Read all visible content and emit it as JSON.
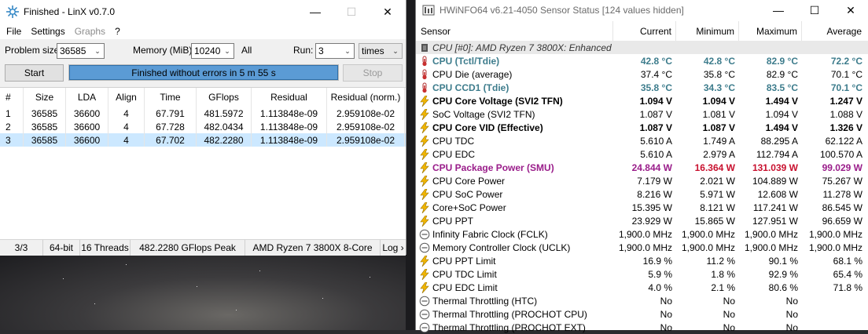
{
  "linx": {
    "title": "Finished - LinX v0.7.0",
    "menu": [
      "File",
      "Settings",
      "Graphs",
      "?"
    ],
    "problem_size_label": "Problem size:",
    "problem_size_value": "36585",
    "memory_label": "Memory (MiB):",
    "memory_value": "10240",
    "all_label": "All",
    "run_label": "Run:",
    "run_value": "3",
    "run_unit": "times",
    "start_label": "Start",
    "stop_label": "Stop",
    "progress_text": "Finished without errors in 5 m 55 s",
    "progress_fraction": 1.0,
    "columns": [
      "#",
      "Size",
      "LDA",
      "Align",
      "Time",
      "GFlops",
      "Residual",
      "Residual (norm.)"
    ],
    "rows": [
      [
        "1",
        "36585",
        "36600",
        "4",
        "67.791",
        "481.5972",
        "1.113848e-09",
        "2.959108e-02"
      ],
      [
        "2",
        "36585",
        "36600",
        "4",
        "67.728",
        "482.0434",
        "1.113848e-09",
        "2.959108e-02"
      ],
      [
        "3",
        "36585",
        "36600",
        "4",
        "67.702",
        "482.2280",
        "1.113848e-09",
        "2.959108e-02"
      ]
    ],
    "status": [
      "3/3",
      "64-bit",
      "16 Threads",
      "482.2280 GFlops Peak",
      "AMD Ryzen 7 3800X 8-Core",
      "Log ›"
    ]
  },
  "hw": {
    "title": "HWiNFO64 v6.21-4050 Sensor Status [124 values hidden]",
    "columns": [
      "Sensor",
      "Current",
      "Minimum",
      "Maximum",
      "Average"
    ],
    "rows": [
      {
        "style": "grp",
        "icon": "chip",
        "name": "CPU [#0]: AMD Ryzen 7 3800X: Enhanced",
        "cur": "",
        "min": "",
        "max": "",
        "avg": ""
      },
      {
        "style": "teal",
        "icon": "therm",
        "name": "CPU (Tctl/Tdie)",
        "cur": "42.8 °C",
        "min": "42.8 °C",
        "max": "82.9 °C",
        "avg": "72.2 °C"
      },
      {
        "style": "",
        "icon": "therm",
        "name": "CPU Die (average)",
        "cur": "37.4 °C",
        "min": "35.8 °C",
        "max": "82.9 °C",
        "avg": "70.1 °C"
      },
      {
        "style": "teal",
        "icon": "therm",
        "name": "CPU CCD1 (Tdie)",
        "cur": "35.8 °C",
        "min": "34.3 °C",
        "max": "83.5 °C",
        "avg": "70.1 °C"
      },
      {
        "style": "bold",
        "icon": "bolt",
        "name": "CPU Core Voltage (SVI2 TFN)",
        "cur": "1.094 V",
        "min": "1.094 V",
        "max": "1.494 V",
        "avg": "1.247 V"
      },
      {
        "style": "",
        "icon": "bolt",
        "name": "SoC Voltage (SVI2 TFN)",
        "cur": "1.087 V",
        "min": "1.081 V",
        "max": "1.094 V",
        "avg": "1.088 V"
      },
      {
        "style": "bold",
        "icon": "bolt",
        "name": "CPU Core VID (Effective)",
        "cur": "1.087 V",
        "min": "1.087 V",
        "max": "1.494 V",
        "avg": "1.326 V"
      },
      {
        "style": "",
        "icon": "bolt",
        "name": "CPU TDC",
        "cur": "5.610 A",
        "min": "1.749 A",
        "max": "88.295 A",
        "avg": "62.122 A"
      },
      {
        "style": "",
        "icon": "bolt",
        "name": "CPU EDC",
        "cur": "5.610 A",
        "min": "2.979 A",
        "max": "112.794 A",
        "avg": "100.570 A"
      },
      {
        "style": "purp",
        "icon": "bolt",
        "name": "CPU Package Power (SMU)",
        "cur": "24.844 W",
        "min": "16.364 W",
        "max": "131.039 W",
        "avg": "99.029 W"
      },
      {
        "style": "",
        "icon": "bolt",
        "name": "CPU Core Power",
        "cur": "7.179 W",
        "min": "2.021 W",
        "max": "104.889 W",
        "avg": "75.267 W"
      },
      {
        "style": "",
        "icon": "bolt",
        "name": "CPU SoC Power",
        "cur": "8.216 W",
        "min": "5.971 W",
        "max": "12.608 W",
        "avg": "11.278 W"
      },
      {
        "style": "",
        "icon": "bolt",
        "name": "Core+SoC Power",
        "cur": "15.395 W",
        "min": "8.121 W",
        "max": "117.241 W",
        "avg": "86.545 W"
      },
      {
        "style": "",
        "icon": "bolt",
        "name": "CPU PPT",
        "cur": "23.929 W",
        "min": "15.865 W",
        "max": "127.951 W",
        "avg": "96.659 W"
      },
      {
        "style": "",
        "icon": "clock",
        "name": "Infinity Fabric Clock (FCLK)",
        "cur": "1,900.0 MHz",
        "min": "1,900.0 MHz",
        "max": "1,900.0 MHz",
        "avg": "1,900.0 MHz"
      },
      {
        "style": "",
        "icon": "clock",
        "name": "Memory Controller Clock (UCLK)",
        "cur": "1,900.0 MHz",
        "min": "1,900.0 MHz",
        "max": "1,900.0 MHz",
        "avg": "1,900.0 MHz"
      },
      {
        "style": "",
        "icon": "bolt",
        "name": "CPU PPT Limit",
        "cur": "16.9 %",
        "min": "11.2 %",
        "max": "90.1 %",
        "avg": "68.1 %"
      },
      {
        "style": "",
        "icon": "bolt",
        "name": "CPU TDC Limit",
        "cur": "5.9 %",
        "min": "1.8 %",
        "max": "92.9 %",
        "avg": "65.4 %"
      },
      {
        "style": "",
        "icon": "bolt",
        "name": "CPU EDC Limit",
        "cur": "4.0 %",
        "min": "2.1 %",
        "max": "80.6 %",
        "avg": "71.8 %"
      },
      {
        "style": "",
        "icon": "clock",
        "name": "Thermal Throttling (HTC)",
        "cur": "No",
        "min": "No",
        "max": "No",
        "avg": ""
      },
      {
        "style": "",
        "icon": "clock",
        "name": "Thermal Throttling (PROCHOT CPU)",
        "cur": "No",
        "min": "No",
        "max": "No",
        "avg": ""
      },
      {
        "style": "",
        "icon": "clock",
        "name": "Thermal Throttling (PROCHOT EXT)",
        "cur": "No",
        "min": "No",
        "max": "No",
        "avg": ""
      }
    ]
  },
  "colors": {
    "progress_fill": "#5b9bd5",
    "selected_row": "#cce8ff",
    "teal_text": "#3d7c8c",
    "purple_text": "#9a1d8a",
    "max_red": "#c8102e",
    "bolt_yellow": "#f2b600"
  }
}
